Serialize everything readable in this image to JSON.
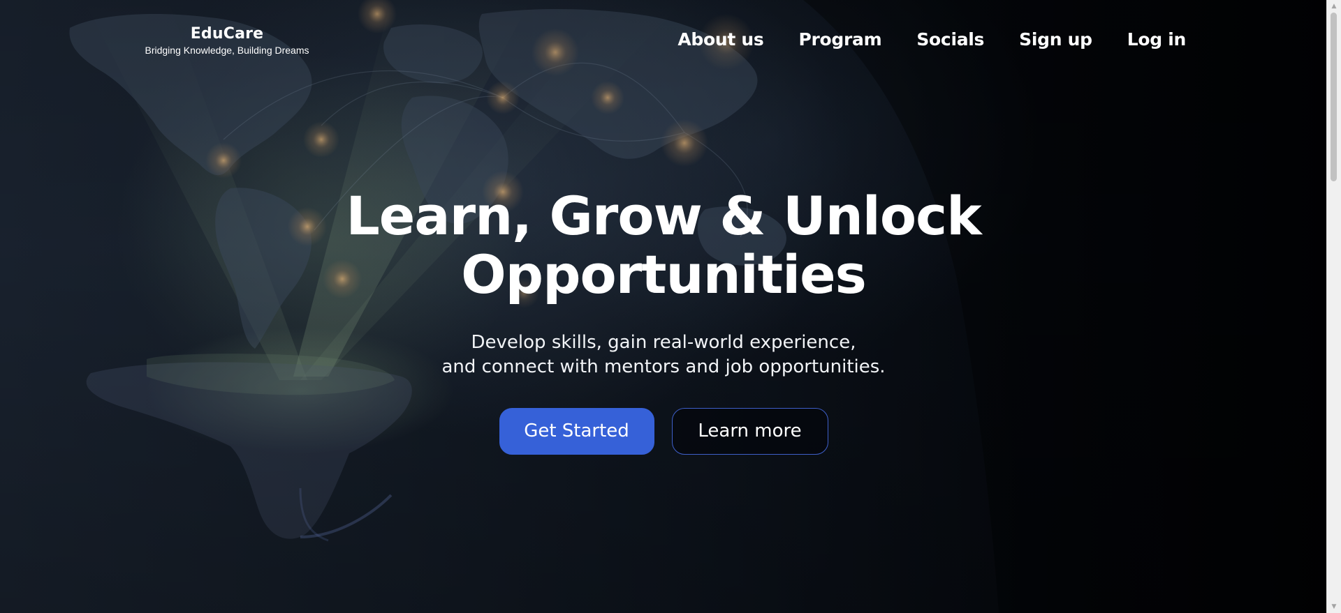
{
  "brand": {
    "name": "EduCare",
    "tagline": "Bridging Knowledge, Building Dreams"
  },
  "nav": {
    "items": [
      {
        "label": "About us"
      },
      {
        "label": "Program"
      },
      {
        "label": "Socials"
      },
      {
        "label": "Sign up"
      },
      {
        "label": "Log in"
      }
    ]
  },
  "hero": {
    "title_line1": "Learn, Grow & Unlock",
    "title_line2": "Opportunities",
    "subtitle_line1": "Develop skills, gain real-world experience,",
    "subtitle_line2": "and connect with mentors and job opportunities.",
    "primary_cta": "Get Started",
    "secondary_cta": "Learn more"
  },
  "colors": {
    "primary_button": "#3661d8",
    "secondary_button_border": "#3e5fc9",
    "text": "#ffffff",
    "background": "#04070d"
  },
  "background_image": "world-map-glowing-hand-icon"
}
